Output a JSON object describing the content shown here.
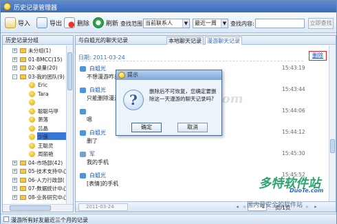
{
  "window": {
    "title": "历史记录管理器"
  },
  "toolbar": {
    "import_label": "导入",
    "export_label": "导出",
    "delete_label": "删除",
    "refresh_label": "刷新",
    "range_label": "查找范围:",
    "range_value": "当前联系人",
    "period_value": "最近一周",
    "content_label": "查找内容:",
    "search_button": "立即查找"
  },
  "left": {
    "header": "历史记录分组",
    "tree": [
      {
        "label": "未分组(1)",
        "expander": "+",
        "type": "folder"
      },
      {
        "label": "01-BMCC(15)",
        "expander": "+",
        "type": "folder"
      },
      {
        "label": "02-桌量(20)",
        "expander": "+",
        "type": "folder"
      },
      {
        "label": "03-我的团队(9)",
        "expander": "-",
        "type": "folder"
      },
      {
        "label": "Eric",
        "type": "buddy"
      },
      {
        "label": "Tara",
        "type": "buddy"
      },
      {
        "label": "白姐光",
        "type": "buddy",
        "selected": true
      },
      {
        "label": "聪聪马甲",
        "type": "buddy"
      },
      {
        "label": "萧落",
        "type": "buddy"
      },
      {
        "label": "吕晶",
        "type": "buddy"
      },
      {
        "label": "少侠",
        "type": "buddy"
      },
      {
        "label": "王聪灵",
        "type": "buddy"
      },
      {
        "label": "周丽艳",
        "type": "buddy"
      },
      {
        "label": "04-市场部(42)",
        "expander": "+",
        "type": "folder"
      },
      {
        "label": "05-技术支持中心",
        "expander": "+",
        "type": "folder"
      },
      {
        "label": "06-人力行政部(",
        "expander": "+",
        "type": "folder"
      },
      {
        "label": "07-数据统计中心",
        "expander": "+",
        "type": "folder"
      },
      {
        "label": "08-业务研究中心",
        "expander": "+",
        "type": "folder"
      }
    ]
  },
  "right": {
    "header": "与白姐光的聊天记录",
    "tabs": [
      {
        "label": "本地聊天记录",
        "active": false
      },
      {
        "label": "漫游聊天记录",
        "active": true
      }
    ],
    "date_heading": "日期: 2011-03-24",
    "delete_link": "删除",
    "messages": [
      {
        "sender": "白姐光",
        "time": "15:43:19",
        "text": "不想漫游咋办",
        "self": false
      },
      {
        "sender": "白姐光",
        "time": "15:43:44",
        "text": "只能删除漫游",
        "self": false
      },
      {
        "sender": "",
        "time": "15:44:06",
        "text": "嗯",
        "self": false
      },
      {
        "sender": "白姐光",
        "time": "15:44:12",
        "text": "删了",
        "self": false
      },
      {
        "sender": "军",
        "time": "15:45:30",
        "text": "我的手机",
        "self": true
      },
      {
        "sender": "白姐光",
        "time": "15:45:52",
        "text": "[表情]的手机",
        "self": false
      }
    ],
    "pager": {
      "date_box": "2011-03-24",
      "page": "1",
      "page_info": "页/1页"
    }
  },
  "status": {
    "text": "漫游所有好友最近三个月的记录"
  },
  "dialog": {
    "title": "提示",
    "icon": "question-icon",
    "message": "删除后不可恢复，您确定要删除这一天漫游的聊天记录吗?",
    "ok": "确定",
    "cancel": "取消"
  },
  "watermarks": {
    "center": "www.DuoTe.com",
    "logo": "多特软件站",
    "domain": "DuoTe.com",
    "slogan": "国内最安全的软件站"
  },
  "colors": {
    "accent": "#3875d7",
    "link": "#1b50b8",
    "highlight_border": "#e02020"
  }
}
